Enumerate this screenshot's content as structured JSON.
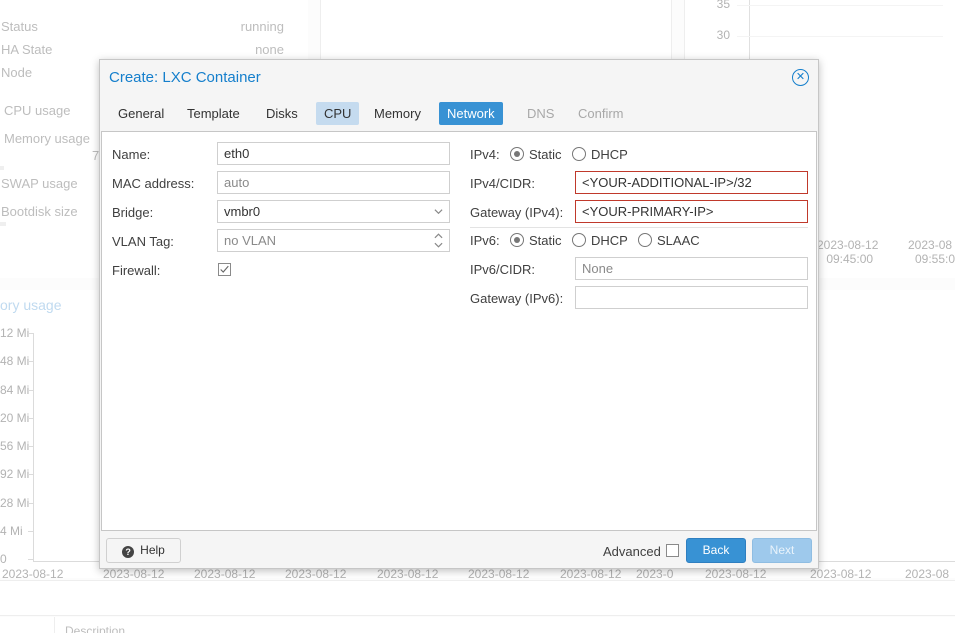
{
  "background": {
    "status_rows": [
      {
        "key": "Status",
        "value": "running"
      },
      {
        "key": "HA State",
        "value": "none"
      },
      {
        "key": "Node",
        "value": ""
      }
    ],
    "usage_labels": [
      "CPU usage",
      "Memory usage",
      "SWAP usage",
      "Bootdisk size"
    ],
    "memory_fragment": "7",
    "right_chart": {
      "y_ticks": [
        "35",
        "30"
      ],
      "x_ticks": [
        {
          "line1": "2023-08-12",
          "line2": "09:45:00"
        },
        {
          "line1": "2023-08",
          "line2": "09:55:0"
        }
      ]
    },
    "memory_chart": {
      "title": "ory usage",
      "y_ticks": [
        "12 Mi",
        "48 Mi",
        "84 Mi",
        "20 Mi",
        "56 Mi",
        "92 Mi",
        "28 Mi",
        "4 Mi",
        "0"
      ],
      "x_ticks": [
        "2023-08-12",
        "2023-08-12",
        "2023-08-12",
        "2023-08-12",
        "2023-08-12",
        "2023-08-12",
        "2023-08-12",
        "2023-0",
        "2023-08-12",
        "2023-08-12",
        "2023-08"
      ]
    },
    "description_label": "Description"
  },
  "dialog": {
    "title": "Create: LXC Container",
    "close_icon": "close-icon",
    "tabs": [
      {
        "label": "General",
        "state": "normal"
      },
      {
        "label": "Template",
        "state": "normal"
      },
      {
        "label": "Disks",
        "state": "normal"
      },
      {
        "label": "CPU",
        "state": "hover"
      },
      {
        "label": "Memory",
        "state": "normal"
      },
      {
        "label": "Network",
        "state": "active"
      },
      {
        "label": "DNS",
        "state": "disabled"
      },
      {
        "label": "Confirm",
        "state": "disabled"
      }
    ],
    "left": {
      "name_label": "Name:",
      "name_value": "eth0",
      "mac_label": "MAC address:",
      "mac_placeholder": "auto",
      "bridge_label": "Bridge:",
      "bridge_value": "vmbr0",
      "vlan_label": "VLAN Tag:",
      "vlan_placeholder": "no VLAN",
      "firewall_label": "Firewall:",
      "firewall_checked": true
    },
    "right": {
      "ipv4_label": "IPv4:",
      "ipv4_options": [
        {
          "label": "Static",
          "selected": true
        },
        {
          "label": "DHCP",
          "selected": false
        }
      ],
      "ipv4_cidr_label": "IPv4/CIDR:",
      "ipv4_cidr_value": "<YOUR-ADDITIONAL-IP>/32",
      "gateway4_label": "Gateway (IPv4):",
      "gateway4_value": "<YOUR-PRIMARY-IP>",
      "ipv6_label": "IPv6:",
      "ipv6_options": [
        {
          "label": "Static",
          "selected": true
        },
        {
          "label": "DHCP",
          "selected": false
        },
        {
          "label": "SLAAC",
          "selected": false
        }
      ],
      "ipv6_cidr_label": "IPv6/CIDR:",
      "ipv6_cidr_placeholder": "None",
      "gateway6_label": "Gateway (IPv6):",
      "gateway6_value": ""
    },
    "footer": {
      "help_label": "Help",
      "advanced_label": "Advanced",
      "advanced_checked": false,
      "back_label": "Back",
      "next_label": "Next"
    },
    "colors": {
      "accent": "#3892d4",
      "title": "#157fcc",
      "error_border": "#c0392b",
      "next_disabled": "#9ec9ec"
    }
  }
}
